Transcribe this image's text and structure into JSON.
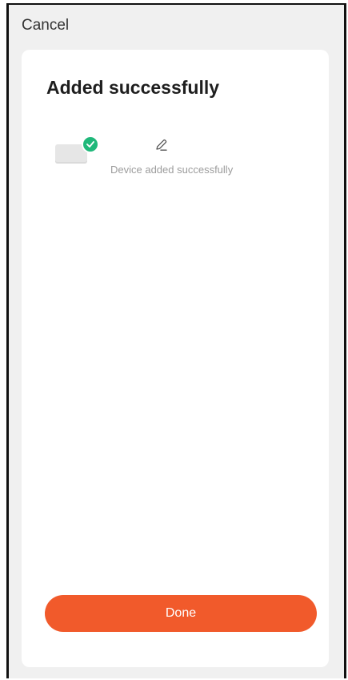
{
  "header": {
    "cancel_label": "Cancel"
  },
  "card": {
    "title": "Added successfully",
    "device": {
      "status_text": "Device added successfully",
      "image_icon": "device-icon",
      "badge_icon": "check-circle-icon",
      "edit_icon": "pencil-icon"
    },
    "done_label": "Done"
  },
  "colors": {
    "accent": "#f15a2b",
    "success": "#1fb87a",
    "background": "#f0f0f0",
    "card": "#ffffff"
  }
}
